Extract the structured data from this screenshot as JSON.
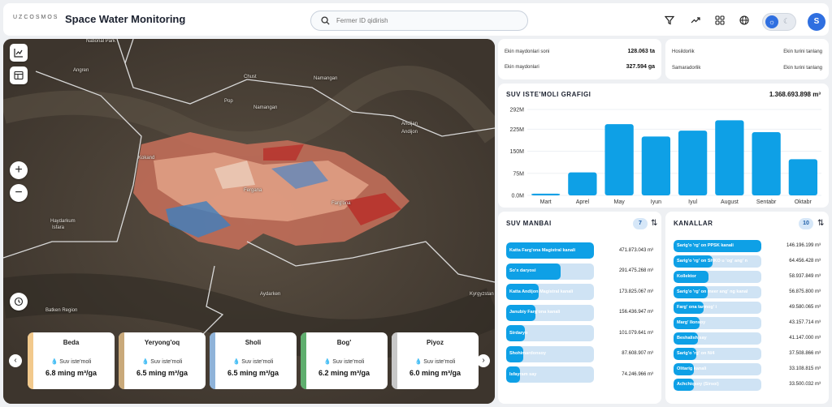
{
  "header": {
    "logo": "UZCOSMOS",
    "title": "Space Water Monitoring",
    "search_placeholder": "Fermer ID qidirish",
    "avatar": "S"
  },
  "icons": [
    "filter-icon",
    "trend-icon",
    "grid-icon",
    "globe-icon",
    "sun-icon",
    "moon-icon",
    "search-icon",
    "chart-icon",
    "table-icon",
    "history-icon"
  ],
  "map": {
    "zoom_in": "+",
    "zoom_out": "−",
    "places": [
      "National Park",
      "Angren",
      "Chust",
      "Pop",
      "Namangan",
      "Andijan",
      "Andijon",
      "Fergana",
      "Farg'ona",
      "Kokand",
      "Haydarkum",
      "Isfara",
      "Batken Region",
      "Aydarken",
      "Kyrgyzstan"
    ],
    "cards": [
      {
        "name": "Beda",
        "metric": "Suv iste'moli",
        "value": "6.8 ming m³/ga",
        "color": "#f2c98c"
      },
      {
        "name": "Yeryong'oq",
        "metric": "Suv iste'moli",
        "value": "6.5 ming m³/ga",
        "color": "#c9a97a"
      },
      {
        "name": "Sholi",
        "metric": "Suv iste'moli",
        "value": "6.5 ming m³/ga",
        "color": "#8fb3d9"
      },
      {
        "name": "Bog'",
        "metric": "Suv iste'moli",
        "value": "6.2 ming m³/ga",
        "color": "#5fae6e"
      },
      {
        "name": "Piyoz",
        "metric": "Suv iste'moli",
        "value": "6.0 ming m³/ga",
        "color": "#c8c8c8"
      }
    ]
  },
  "stats_left": [
    {
      "label": "Ekin maydonlari soni",
      "value": "128.063 ta"
    },
    {
      "label": "Ekin maydonlari",
      "value": "327.594 ga"
    }
  ],
  "stats_right": [
    {
      "label": "Hosildorlik",
      "value": "Ekin turini tanlang"
    },
    {
      "label": "Samaradorlik",
      "value": "Ekin turini tanlang"
    }
  ],
  "chart_data": {
    "type": "bar",
    "title": "SUV ISTE'MOLI GRAFIGI",
    "total": "1.368.693.898 m³",
    "categories": [
      "Mart",
      "Aprel",
      "May",
      "Iyun",
      "Iyul",
      "August",
      "Sentabr",
      "Oktabr"
    ],
    "values": [
      6,
      78,
      242,
      200,
      220,
      255,
      215,
      123
    ],
    "yticks": [
      "0.0M",
      "75M",
      "150M",
      "225M",
      "292M"
    ],
    "ylim": [
      0,
      292
    ],
    "unit": "M",
    "color": "#0ea0e6"
  },
  "sources": {
    "title": "SUV MANBAI",
    "count": "7",
    "items": [
      {
        "label": "Katta Farg'ona Magistral kanali",
        "value": "471.873.043 m³",
        "frac": 1.0
      },
      {
        "label": "So'x daryosi",
        "value": "291.475.268 m³",
        "frac": 0.62
      },
      {
        "label": "Katta Andijon Magistral kanali",
        "value": "173.825.067 m³",
        "frac": 0.37
      },
      {
        "label": "Janubiy Farg'ona kanali",
        "value": "156.436.947 m³",
        "frac": 0.33
      },
      {
        "label": "Sirdaryo",
        "value": "101.079.641 m³",
        "frac": 0.21
      },
      {
        "label": "Shohimardonsoy",
        "value": "87.608.907 m³",
        "frac": 0.19
      },
      {
        "label": "Isfayram say",
        "value": "74.246.966 m³",
        "frac": 0.16
      }
    ]
  },
  "canals": {
    "title": "KANALLAR",
    "count": "10",
    "items": [
      {
        "label": "Sarig'o 'rg' on PPSK kanali",
        "value": "146.196.199 m³",
        "frac": 1.0
      },
      {
        "label": "Sarig'o 'rg' on SHKO u 'og' ang' n",
        "value": "64.456.428 m³",
        "frac": 0.44
      },
      {
        "label": "Kollektor",
        "value": "58.937.849 m³",
        "frac": 0.4
      },
      {
        "label": "Sarig'o 'rg' on meer ang' ng kanal",
        "value": "56.875.800 m³",
        "frac": 0.39
      },
      {
        "label": "Farg' ona tarmog' i",
        "value": "49.580.065 m³",
        "frac": 0.34
      },
      {
        "label": "Marg' Ilonsoy",
        "value": "43.157.714 m³",
        "frac": 0.3
      },
      {
        "label": "Beshalish say",
        "value": "41.147.000 m³",
        "frac": 0.28
      },
      {
        "label": "Sarig'o 'rg' on N/4",
        "value": "37.508.866 m³",
        "frac": 0.26
      },
      {
        "label": "Olitarig kanali",
        "value": "33.108.815 m³",
        "frac": 0.23
      },
      {
        "label": "Achchiqsoy (Sirsoi)",
        "value": "33.500.032 m³",
        "frac": 0.23
      }
    ]
  }
}
